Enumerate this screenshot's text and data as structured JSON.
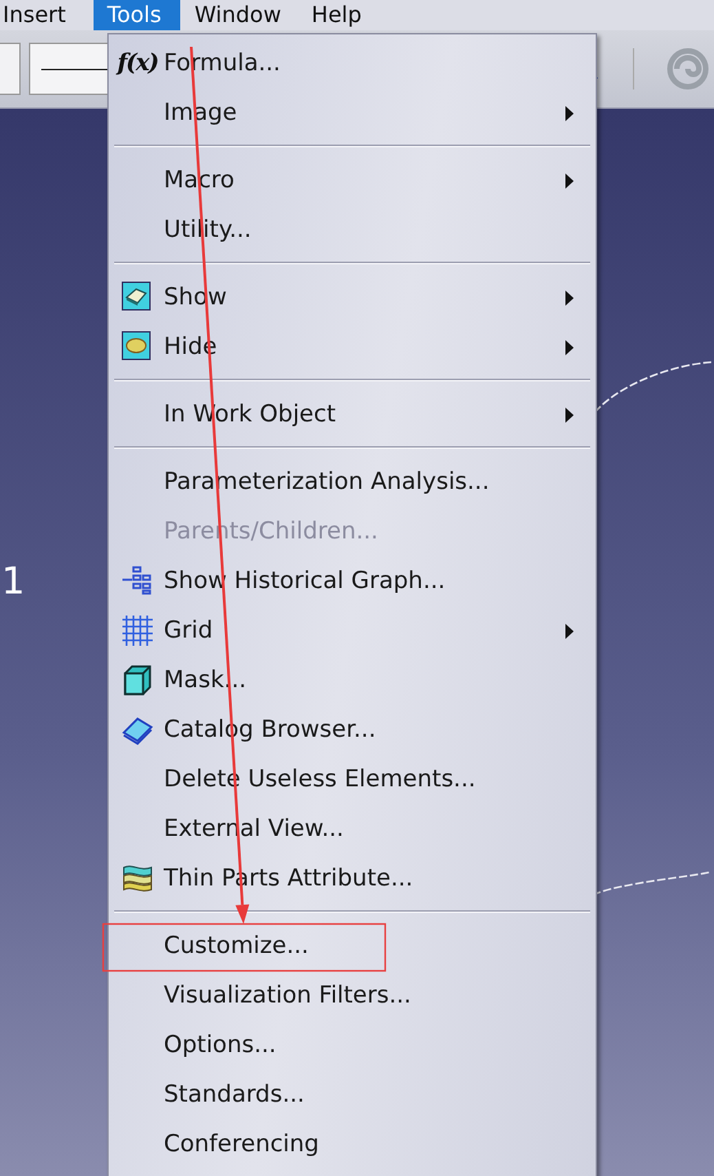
{
  "menu_bar": [
    {
      "label": "Insert",
      "selected": false
    },
    {
      "label": "Tools",
      "selected": true
    },
    {
      "label": "Window",
      "selected": false
    },
    {
      "label": "Help",
      "selected": false
    }
  ],
  "canvas": {
    "label": "1"
  },
  "tools_menu": {
    "arrow_annotation": true,
    "groups": [
      [
        {
          "label": "Formula...",
          "glyph": "f(x)",
          "submenu": false,
          "disabled": false,
          "boxed": false
        },
        {
          "label": "Image",
          "submenu": true,
          "disabled": false,
          "boxed": false
        }
      ],
      [
        {
          "label": "Macro",
          "submenu": true,
          "disabled": false,
          "boxed": false
        },
        {
          "label": "Utility...",
          "submenu": false,
          "disabled": false,
          "boxed": false
        }
      ],
      [
        {
          "label": "Show",
          "kind": "show",
          "submenu": true,
          "disabled": false,
          "boxed": false
        },
        {
          "label": "Hide",
          "kind": "hide",
          "submenu": true,
          "disabled": false,
          "boxed": false
        }
      ],
      [
        {
          "label": "In Work Object",
          "submenu": true,
          "disabled": false,
          "boxed": false
        }
      ],
      [
        {
          "label": "Parameterization Analysis...",
          "submenu": false,
          "disabled": false,
          "boxed": false
        },
        {
          "label": "Parents/Children...",
          "submenu": false,
          "disabled": true,
          "boxed": false
        },
        {
          "label": "Show Historical Graph...",
          "kind": "graph",
          "submenu": false,
          "disabled": false,
          "boxed": false
        },
        {
          "label": "Grid",
          "kind": "grid",
          "submenu": true,
          "disabled": false,
          "boxed": false
        },
        {
          "label": "Mask...",
          "kind": "cube",
          "submenu": false,
          "disabled": false,
          "boxed": false
        },
        {
          "label": "Catalog Browser...",
          "kind": "book",
          "submenu": false,
          "disabled": false,
          "boxed": false
        },
        {
          "label": "Delete Useless Elements...",
          "submenu": false,
          "disabled": false,
          "boxed": false
        },
        {
          "label": "External View...",
          "submenu": false,
          "disabled": false,
          "boxed": false
        },
        {
          "label": "Thin Parts Attribute...",
          "kind": "layers",
          "submenu": false,
          "disabled": false,
          "boxed": false
        }
      ],
      [
        {
          "label": "Customize...",
          "submenu": false,
          "disabled": false,
          "boxed": true
        },
        {
          "label": "Visualization Filters...",
          "submenu": false,
          "disabled": false,
          "boxed": false
        },
        {
          "label": "Options...",
          "submenu": false,
          "disabled": false,
          "boxed": false
        },
        {
          "label": "Standards...",
          "submenu": false,
          "disabled": false,
          "boxed": false
        },
        {
          "label": "Conferencing",
          "submenu": false,
          "disabled": false,
          "boxed": false
        }
      ]
    ]
  }
}
